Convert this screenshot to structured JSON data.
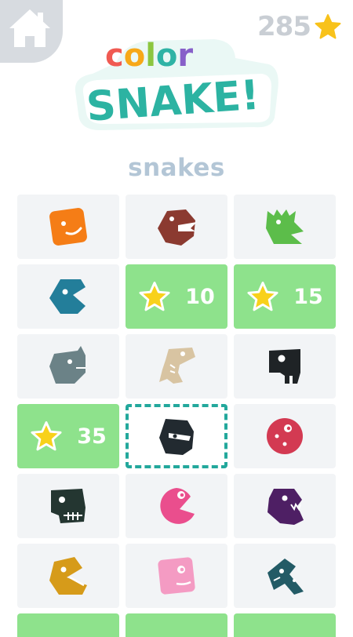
{
  "header": {
    "star_count": "285",
    "logo_top": "color",
    "logo_bottom": "SNAKE!"
  },
  "section_title": "snakes",
  "colors": {
    "accent_green": "#8ee28c",
    "selected_border": "#23a89c",
    "cell_bg": "#f2f4f6"
  },
  "snakes": [
    {
      "icon": "orange-smile-snake-icon",
      "color": "#f57d16",
      "state": "unlocked"
    },
    {
      "icon": "red-fanged-snake-icon",
      "color": "#8b3a30",
      "state": "unlocked"
    },
    {
      "icon": "green-crocodile-snake-icon",
      "color": "#5cbd4a",
      "state": "unlocked"
    },
    {
      "icon": "teal-pacman-snake-icon",
      "color": "#237e9a",
      "state": "unlocked"
    },
    {
      "icon": "star-icon",
      "price": "10",
      "state": "locked"
    },
    {
      "icon": "star-icon",
      "price": "15",
      "state": "locked"
    },
    {
      "icon": "gray-rhino-snake-icon",
      "color": "#6b8287",
      "state": "unlocked"
    },
    {
      "icon": "beige-dino-skull-snake-icon",
      "color": "#d8c4a2",
      "state": "unlocked"
    },
    {
      "icon": "black-skull-snake-icon",
      "color": "#1f2326",
      "state": "unlocked"
    },
    {
      "icon": "star-icon",
      "price": "35",
      "state": "locked"
    },
    {
      "icon": "black-ninja-snake-icon",
      "color": "#222a30",
      "state": "selected"
    },
    {
      "icon": "red-cookie-snake-icon",
      "color": "#d33a52",
      "state": "unlocked"
    },
    {
      "icon": "dark-green-skull-snake-icon",
      "color": "#243631",
      "state": "unlocked"
    },
    {
      "icon": "pink-pacman-snake-icon",
      "color": "#ea4e8d",
      "state": "unlocked"
    },
    {
      "icon": "purple-monster-snake-icon",
      "color": "#4e1f64",
      "state": "unlocked"
    },
    {
      "icon": "yellow-duck-snake-icon",
      "color": "#d69b1a",
      "state": "unlocked"
    },
    {
      "icon": "pink-square-snake-icon",
      "color": "#f49bc3",
      "state": "unlocked"
    },
    {
      "icon": "teal-robot-snake-icon",
      "color": "#235b66",
      "state": "unlocked"
    }
  ]
}
